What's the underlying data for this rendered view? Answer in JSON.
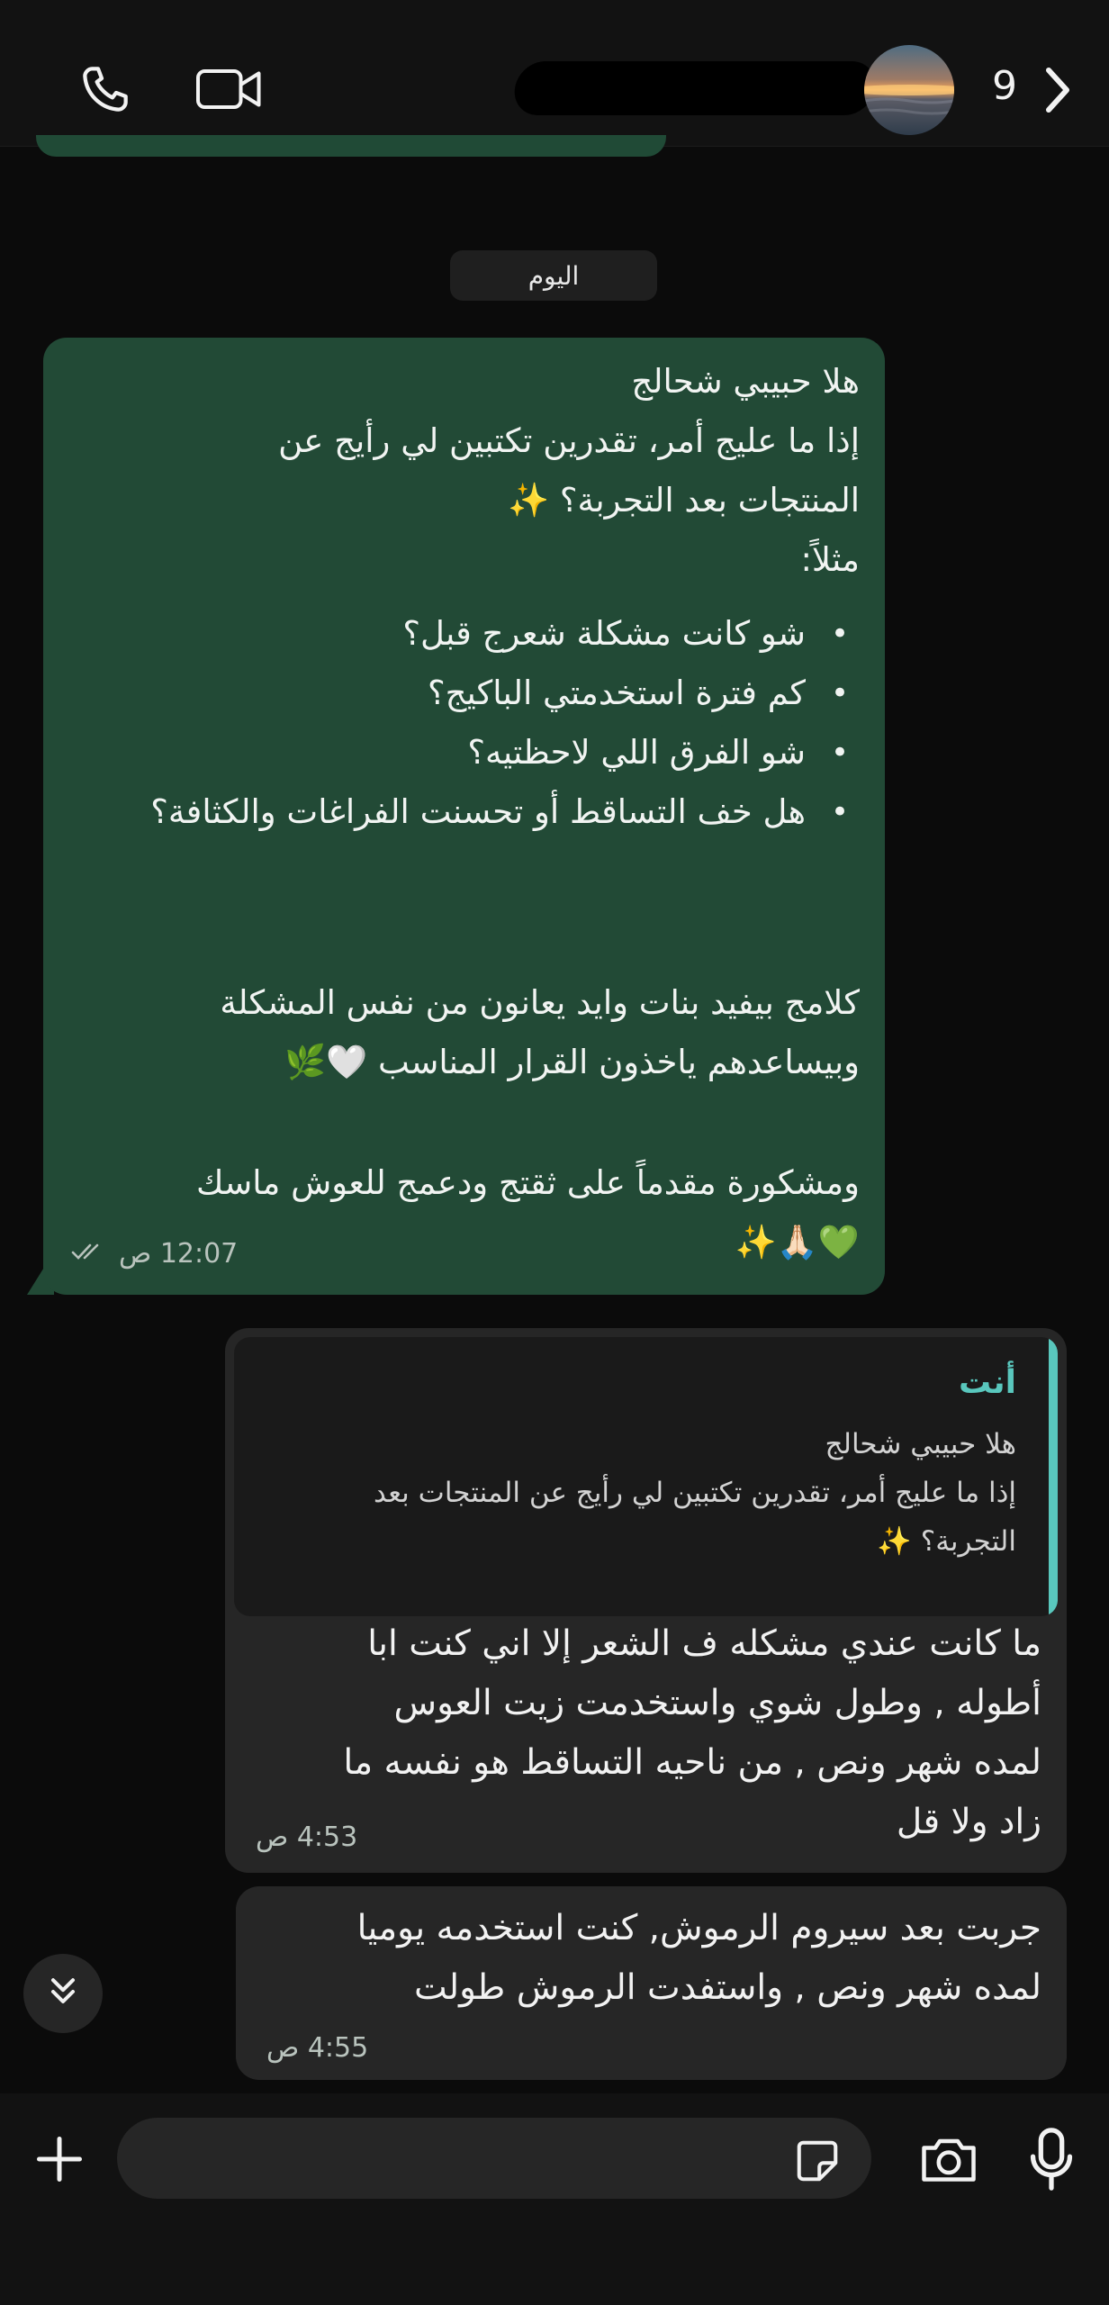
{
  "header": {
    "back_count": "9",
    "icons": {
      "call": "phone-icon",
      "video": "video-camera-icon",
      "back": "chevron-right-icon"
    }
  },
  "date_divider": "اليوم",
  "incoming_message": {
    "text": "هلا حبيبي شحالج\nإذا ما عليج أمر، تقدرين تكتبين لي رأيج عن\nالمنتجات بعد التجربة؟ ✨\nمثلاً:",
    "bullets": [
      "شو كانت مشكلة شعرج قبل؟",
      "كم فترة استخدمتي الباكيج؟",
      "شو الفرق اللي لاحظتيه؟",
      "هل خف التساقط أو تحسنت الفراغات والكثافة؟"
    ],
    "paragraph2": "كلامج بيفيد بنات وايد يعانون من نفس المشكلة\nوبيساعدهم ياخذون القرار المناسب 🤍🌿",
    "paragraph3": "ومشكورة مقدماً على ثقتج ودعمج للعوش ماسك\n💚🙏🏻✨",
    "time": "12:07 ص",
    "status_icon": "double-check-icon"
  },
  "reply_message": {
    "quote_sender": "أنت",
    "quote_text": "هلا حبيبي شحالج\nإذا ما عليج أمر، تقدرين تكتبين لي رأيج عن المنتجات بعد\nالتجربة؟ ✨",
    "text": "ما كانت عندي مشكله ف الشعر إلا اني كنت ابا\nأطوله , وطول شوي واستخدمت زيت العوس\nلمده شهر ونص , من ناحيه التساقط هو نفسه ما\nزاد ولا قل",
    "time": "4:53 ص"
  },
  "second_message": {
    "text": "جربت بعد سيروم الرموش, كنت استخدمه يوميا\nلمده شهر ونص , واستفدت الرموش طولت",
    "time": "4:55 ص"
  },
  "composer": {
    "icons": {
      "add": "plus-icon",
      "sticker": "sticker-icon",
      "camera": "camera-icon",
      "mic": "microphone-icon"
    }
  },
  "colors": {
    "incoming_bubble": "#224a36",
    "outgoing_bubble": "#262626",
    "quote_accent": "#59c7bd",
    "background": "#0b0b0b"
  }
}
